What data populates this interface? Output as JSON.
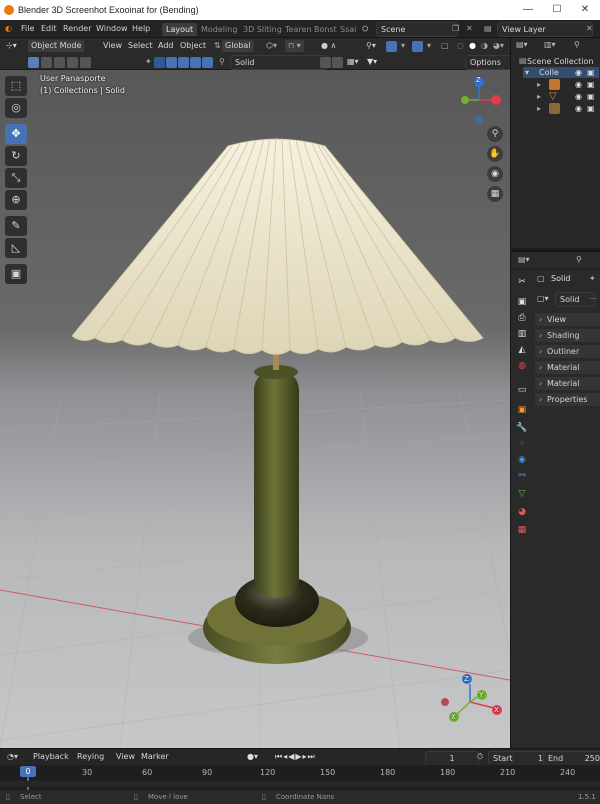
{
  "window": {
    "title": "Blender  3D Screenhot Exooinat for (Bending)",
    "minimize": "—",
    "maximize": "☐",
    "close": "✕"
  },
  "menu": {
    "file": "File",
    "edit": "Edit",
    "render": "Render",
    "window": "Window",
    "help": "Help"
  },
  "workspaces": [
    "Layout",
    "Modeling",
    "3D Sliting",
    "Tearen Bonst",
    "Ssai"
  ],
  "scene": {
    "label": "Scene",
    "view_layer": "View Layer"
  },
  "header": {
    "mode": "Object Mode",
    "view": "View",
    "select": "Select",
    "add": "Add",
    "object": "Object",
    "orientation": "Global",
    "shading_search": "Solid",
    "options": "Options"
  },
  "viewport": {
    "perspective": "User Panasporte",
    "collection": "(1) Collections | Solid"
  },
  "gizmo": {
    "z": "Z",
    "x": "X",
    "y": "Y"
  },
  "outliner": {
    "title": "Scene Collection",
    "collection": "Colle"
  },
  "properties": {
    "object_name": "Solid",
    "dropdown": "Solid",
    "panels": [
      "View",
      "Shading",
      "Outliner",
      "Material",
      "Material",
      "Properties"
    ]
  },
  "timeline": {
    "playback": "Playback",
    "keying": "Reying",
    "view": "View",
    "marker": "Marker",
    "current_frame": "1",
    "start_label": "Start",
    "start": "1",
    "end_label": "End",
    "end": "250"
  },
  "ruler": {
    "current": "0",
    "ticks": [
      "30",
      "60",
      "90",
      "120",
      "150",
      "180",
      "180",
      "210",
      "240"
    ]
  },
  "status": {
    "select": "Select",
    "move": "Move l love",
    "coord": "Coordinate Nans",
    "version": "1.5.1"
  },
  "colors": {
    "accent": "#4772b3",
    "brand": "#e87d0d",
    "axis_x": "#e23b4e",
    "axis_y": "#6fb22a",
    "axis_z": "#2d76d6"
  }
}
